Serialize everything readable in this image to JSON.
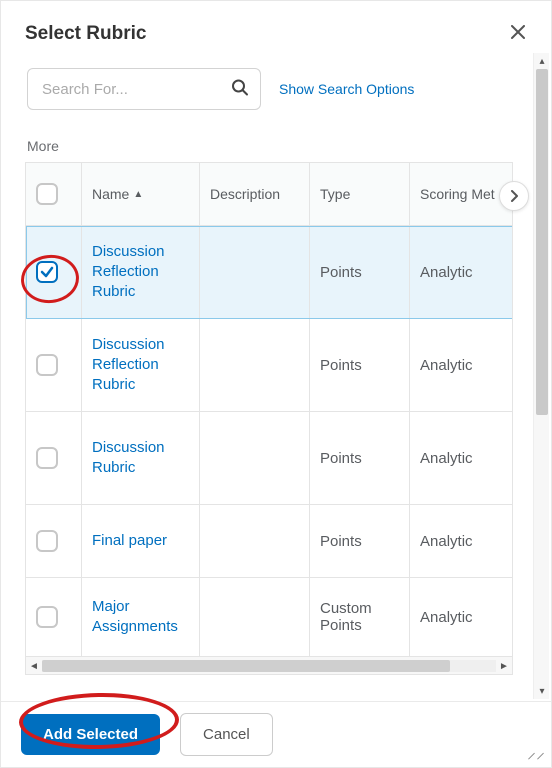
{
  "dialog": {
    "title": "Select Rubric"
  },
  "search": {
    "placeholder": "Search For...",
    "show_options_label": "Show Search Options"
  },
  "more_label": "More",
  "table": {
    "columns": {
      "name": "Name",
      "description": "Description",
      "type": "Type",
      "scoring_method": "Scoring Met"
    },
    "rows": [
      {
        "selected": true,
        "name": "Discussion Reflection Rubric",
        "description": "",
        "type": "Points",
        "scoring_method": "Analytic"
      },
      {
        "selected": false,
        "name": "Discussion Reflection Rubric",
        "description": "",
        "type": "Points",
        "scoring_method": "Analytic"
      },
      {
        "selected": false,
        "name": "Discussion Rubric",
        "description": "",
        "type": "Points",
        "scoring_method": "Analytic"
      },
      {
        "selected": false,
        "name": "Final paper",
        "description": "",
        "type": "Points",
        "scoring_method": "Analytic"
      },
      {
        "selected": false,
        "name": "Major Assignments",
        "description": "",
        "type": "Custom Points",
        "scoring_method": "Analytic"
      }
    ]
  },
  "footer": {
    "add_selected_label": "Add Selected",
    "cancel_label": "Cancel"
  }
}
